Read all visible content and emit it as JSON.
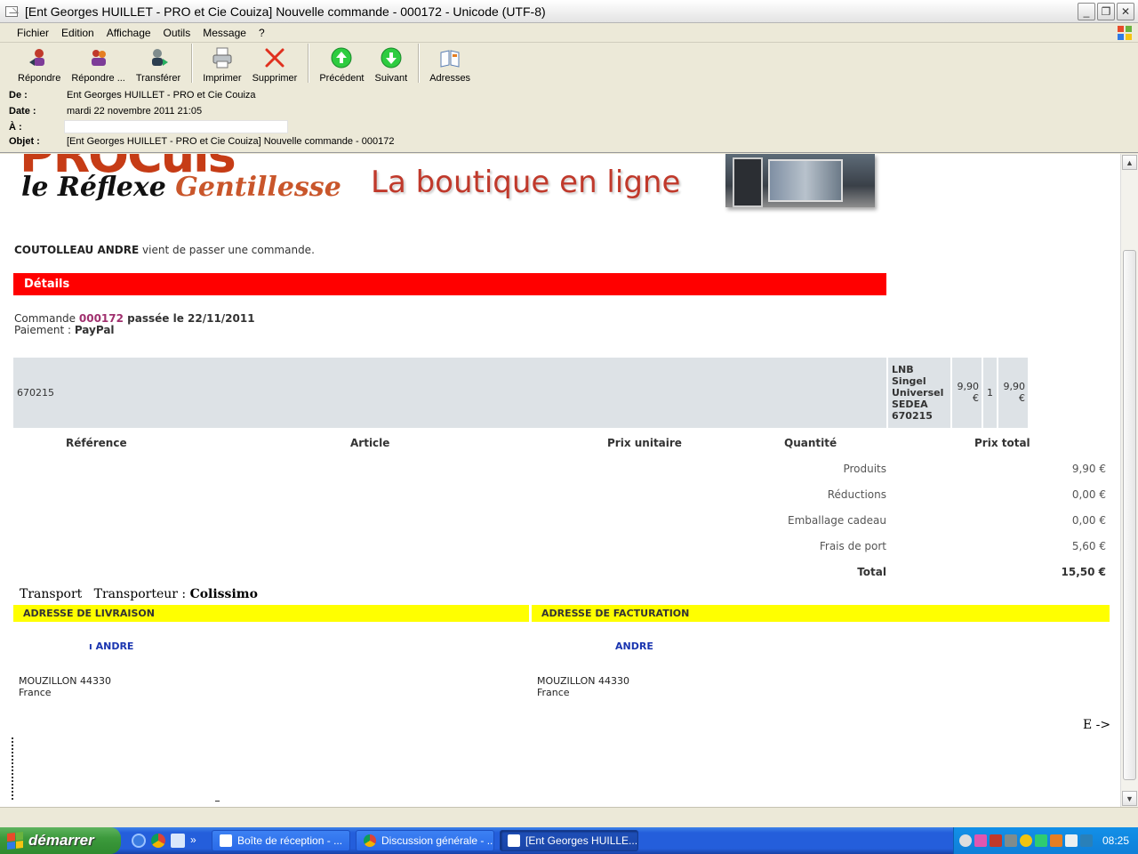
{
  "window": {
    "title": "[Ent Georges HUILLET - PRO et Cie Couiza] Nouvelle commande -  000172 - Unicode (UTF-8)",
    "minimize": "_",
    "maximize": "❐",
    "close": "✕"
  },
  "menu": [
    "Fichier",
    "Edition",
    "Affichage",
    "Outils",
    "Message",
    "?"
  ],
  "toolbar": {
    "reply": "Répondre",
    "reply_all": "Répondre ...",
    "forward": "Transférer",
    "print": "Imprimer",
    "delete": "Supprimer",
    "previous": "Précédent",
    "next": "Suivant",
    "addresses": "Adresses"
  },
  "header": {
    "from_label": "De :",
    "from": "Ent Georges HUILLET - PRO et Cie Couiza",
    "date_label": "Date :",
    "date": "mardi 22 novembre 2011 21:05",
    "to_label": "À :",
    "subject_label": "Objet :",
    "subject": "[Ent Georges HUILLET - PRO et Cie Couiza] Nouvelle commande -  000172"
  },
  "email": {
    "logo_top": "PROCuis",
    "logo_a": "le Réflexe ",
    "logo_b": "Gentillesse",
    "shop_tagline": "La boutique en ligne",
    "customer": "COUTOLLEAU ANDRE",
    "intro": " vient de passer une commande.",
    "details_title": "Détails",
    "order_prefix": "Commande ",
    "order_number": "000172",
    "order_date": " passée le 22/11/2011",
    "payment_label": "Paiement : ",
    "payment": "PayPal",
    "item": {
      "reference": "670215",
      "article": "LNB Singel Universel SEDEA 670215",
      "unit_price": "9,90 €",
      "quantity": "1",
      "total": "9,90 €"
    },
    "columns": [
      "Référence",
      "Article",
      "Prix unitaire",
      "Quantité",
      "Prix total"
    ],
    "summary": [
      {
        "label": "Produits",
        "value": "9,90 €"
      },
      {
        "label": "Réductions",
        "value": "0,00 €"
      },
      {
        "label": "Emballage cadeau",
        "value": "0,00 €"
      },
      {
        "label": "Frais de port",
        "value": "5,60 €"
      },
      {
        "label": "Total",
        "value": "15,50 €"
      }
    ],
    "transport_label": "Transport",
    "carrier_label": "Transporteur : ",
    "carrier": "Colissimo",
    "delivery_title": "ADRESSE DE LIVRAISON",
    "billing_title": "ADRESSE DE FACTURATION",
    "delivery_name": "ANDRE",
    "billing_name": "ANDRE",
    "delivery_city": "MOUZILLON 44330",
    "delivery_country": "France",
    "billing_city": "MOUZILLON 44330",
    "billing_country": "France",
    "footer_frag": "E ->"
  },
  "taskbar": {
    "start": "démarrer",
    "tasks": [
      "Boîte de réception - ...",
      "Discussion générale - ...",
      "[Ent Georges HUILLE..."
    ],
    "clock": "08:25"
  }
}
